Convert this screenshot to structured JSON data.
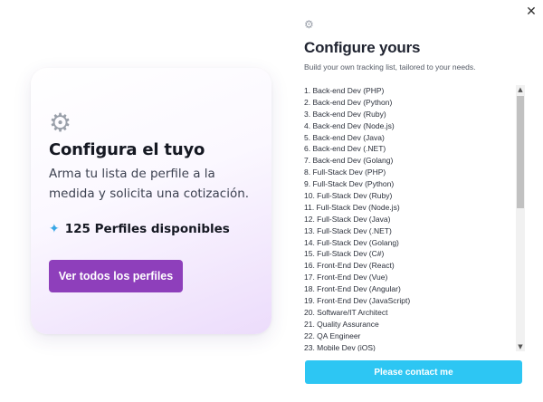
{
  "promo": {
    "title": "Configura el tuyo",
    "description": "Arma tu lista de perfile a la medida y solicita una cotización.",
    "count_label": "125 Perfiles disponibles",
    "cta_label": "Ver todos los perfiles",
    "icons": {
      "gear": "gear-icon",
      "sparkle": "sparkle-icon"
    }
  },
  "panel": {
    "title": "Configure yours",
    "subtitle": "Build your own tracking list, tailored to your needs.",
    "close_icon": "close-icon",
    "items": [
      "1. Back-end Dev (PHP)",
      "2. Back-end Dev (Python)",
      "3. Back-end Dev (Ruby)",
      "4. Back-end Dev (Node.js)",
      "5. Back-end Dev (Java)",
      "6. Back-end Dev (.NET)",
      "7. Back-end Dev (Golang)",
      "8. Full-Stack Dev (PHP)",
      "9. Full-Stack Dev (Python)",
      "10. Full-Stack Dev (Ruby)",
      "11. Full-Stack Dev (Node.js)",
      "12. Full-Stack Dev (Java)",
      "13. Full-Stack Dev (.NET)",
      "14. Full-Stack Dev (Golang)",
      "15. Full-Stack Dev (C#)",
      "16. Front-End Dev (React)",
      "17. Front-End Dev (Vue)",
      "18. Front-End Dev (Angular)",
      "19. Front-End Dev (JavaScript)",
      "20. Software/IT Architect",
      "21. Quality Assurance",
      "22. QA Engineer",
      "23. Mobile Dev (iOS)"
    ],
    "contact_label": "Please contact me"
  },
  "colors": {
    "cta": "#8e3fbb",
    "contact": "#2dc6f3",
    "sparkle": "#38a7e6"
  }
}
